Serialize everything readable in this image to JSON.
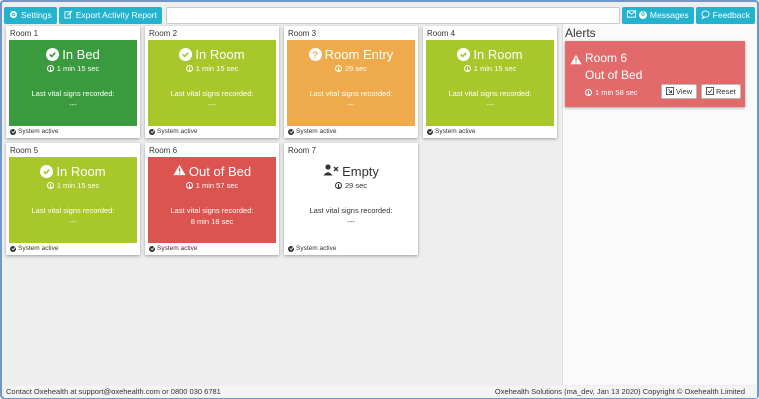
{
  "toolbar": {
    "settings_label": "Settings",
    "export_label": "Export Activity Report",
    "messages_label": "Messages",
    "messages_count": "0",
    "feedback_label": "Feedback"
  },
  "colors": {
    "accent": "#22b3cf",
    "status_dark_green": "#3a9a3e",
    "status_light_green": "#a8c72b",
    "status_orange": "#efab4b",
    "status_red": "#dc5450",
    "alert_red": "#e36a6a"
  },
  "rooms": [
    {
      "title": "Room 1",
      "status": "In Bed",
      "icon": "check-circle-icon",
      "time": "1 min 15 sec",
      "vital_label": "Last vital signs recorded:",
      "vital_value": "---",
      "footer": "System active"
    },
    {
      "title": "Room 2",
      "status": "In Room",
      "icon": "check-circle-icon",
      "time": "1 min 15 sec",
      "vital_label": "Last vital signs recorded:",
      "vital_value": "---",
      "footer": "System active"
    },
    {
      "title": "Room 3",
      "status": "Room Entry",
      "icon": "question-circle-icon",
      "time": "29 sec",
      "vital_label": "Last vital signs recorded:",
      "vital_value": "---",
      "footer": "System active"
    },
    {
      "title": "Room 4",
      "status": "In Room",
      "icon": "check-circle-icon",
      "time": "1 min 15 sec",
      "vital_label": "Last vital signs recorded:",
      "vital_value": "---",
      "footer": "System active"
    },
    {
      "title": "Room 5",
      "status": "In Room",
      "icon": "check-circle-icon",
      "time": "1 min 15 sec",
      "vital_label": "Last vital signs recorded:",
      "vital_value": "---",
      "footer": "System active"
    },
    {
      "title": "Room 6",
      "status": "Out of Bed",
      "icon": "warning-icon",
      "time": "1 min 57 sec",
      "vital_label": "Last vital signs recorded:",
      "vital_value": "8 min 18 sec",
      "footer": "System active"
    },
    {
      "title": "Room 7",
      "status": "Empty",
      "icon": "user-x-icon",
      "time": "29 sec",
      "vital_label": "Last vital signs recorded:",
      "vital_value": "---",
      "footer": "System active"
    }
  ],
  "alerts": {
    "title": "Alerts",
    "items": [
      {
        "room": "Room 6",
        "status": "Out of Bed",
        "time": "1 min 58 sec",
        "view_label": "View",
        "reset_label": "Reset"
      }
    ]
  },
  "footer": {
    "contact": "Contact Oxehealth at support@oxehealth.com or 0800 030 6781",
    "copyright": "Oxehealth Solutions (ma_dev, Jan 13 2020) Copyright © Oxehealth Limited"
  }
}
